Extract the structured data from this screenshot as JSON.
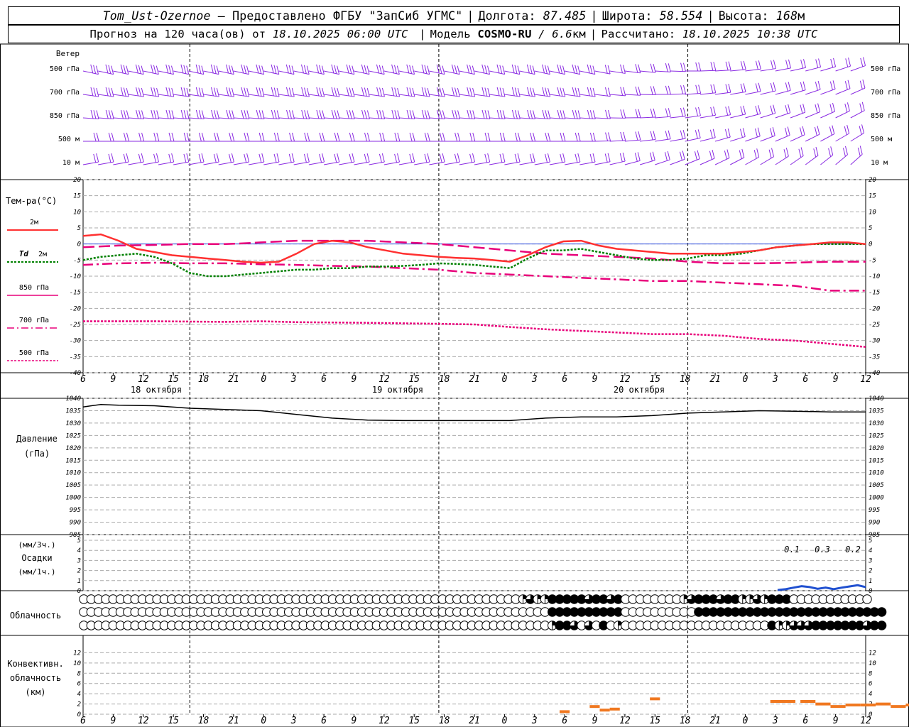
{
  "header": {
    "row1": {
      "station": "Tom_Ust-Ozernoe",
      "dash": " – ",
      "provider": "Предоставлено ФГБУ \"ЗапСиб УГМС\"",
      "lon_label": "Долгота:",
      "lon_value": "87.485",
      "lat_label": "Широта:",
      "lat_value": "58.554",
      "alt_label": "Высота:",
      "alt_value": "168",
      "alt_unit": "м"
    },
    "row2": {
      "forecast_label": "Прогноз на 120 часа(ов) от",
      "forecast_start": "18.10.2025 06:00 UTC",
      "model_label": "Модель",
      "model_name": "COSMO-RU",
      "model_res": "/ 6.6",
      "model_res_unit": "км",
      "calc_label": "Рассчитано:",
      "calc_value": "18.10.2025 10:38 UTC"
    }
  },
  "chart_data": {
    "type": "line",
    "x_hour_labels": [
      "6",
      "9",
      "12",
      "15",
      "18",
      "21",
      "0",
      "3",
      "6",
      "9",
      "12",
      "15",
      "18",
      "21",
      "0",
      "3",
      "6",
      "9",
      "12",
      "15",
      "18",
      "21",
      "0",
      "3",
      "6",
      "9",
      "12"
    ],
    "day_labels": [
      "18 октября",
      "19 октября",
      "20 октября"
    ],
    "colors": {
      "wind": "#8a2be2",
      "t2m": "#ff3030",
      "td2m": "#008000",
      "t850": "#e8007a",
      "t700": "#e8007a",
      "t500": "#e8007a",
      "pressure": "#000000",
      "precip": "#2050d0",
      "conv": "#f07820",
      "grid": "#aaaaaa"
    },
    "wind": {
      "title": "Ветер",
      "levels": [
        "500 гПа",
        "700 гПа",
        "850 гПа",
        "500 м",
        "10 м"
      ],
      "description": "wind barbs every 3 h on five levels"
    },
    "temperature": {
      "title": "Тем-ра(°С)",
      "ylim": [
        -40,
        20
      ],
      "yticks": [
        20,
        15,
        10,
        5,
        0,
        -5,
        -10,
        -15,
        -20,
        -25,
        -30,
        -35,
        -40
      ],
      "legend": {
        "t2m": "2м",
        "td_symbol": "Td",
        "td2m": "2м",
        "t850": "850 гПа",
        "t700": "700 гПа",
        "t500": "500 гПа"
      },
      "series": {
        "t2m": [
          [
            0,
            2.5
          ],
          [
            3,
            3
          ],
          [
            6,
            1
          ],
          [
            9,
            -1.5
          ],
          [
            12,
            -2.5
          ],
          [
            15,
            -3.5
          ],
          [
            18,
            -4
          ],
          [
            21,
            -4.5
          ],
          [
            24,
            -5
          ],
          [
            27,
            -5.5
          ],
          [
            30,
            -5.8
          ],
          [
            33,
            -5.5
          ],
          [
            36,
            -3
          ],
          [
            39,
            0
          ],
          [
            42,
            1
          ],
          [
            45,
            0.5
          ],
          [
            48,
            -1
          ],
          [
            51,
            -2
          ],
          [
            54,
            -3
          ],
          [
            57,
            -3.5
          ],
          [
            60,
            -4
          ],
          [
            63,
            -4.3
          ],
          [
            66,
            -4.5
          ],
          [
            69,
            -5
          ],
          [
            72,
            -5.5
          ],
          [
            75,
            -3.5
          ],
          [
            78,
            -1
          ],
          [
            81,
            0.8
          ],
          [
            84,
            1
          ],
          [
            87,
            -0.5
          ],
          [
            90,
            -1.5
          ],
          [
            93,
            -2
          ],
          [
            96,
            -2.5
          ],
          [
            99,
            -3
          ],
          [
            102,
            -3
          ],
          [
            105,
            -3
          ],
          [
            108,
            -3
          ],
          [
            111,
            -2.5
          ],
          [
            114,
            -2
          ],
          [
            117,
            -1
          ],
          [
            120,
            -0.5
          ],
          [
            123,
            0
          ],
          [
            126,
            0.5
          ],
          [
            129,
            0.5
          ],
          [
            132,
            0
          ]
        ],
        "td2m": [
          [
            0,
            -5
          ],
          [
            3,
            -4
          ],
          [
            6,
            -3.5
          ],
          [
            9,
            -3
          ],
          [
            12,
            -4
          ],
          [
            15,
            -6
          ],
          [
            18,
            -9
          ],
          [
            21,
            -10
          ],
          [
            24,
            -10
          ],
          [
            27,
            -9.5
          ],
          [
            30,
            -9
          ],
          [
            33,
            -8.5
          ],
          [
            36,
            -8
          ],
          [
            39,
            -8
          ],
          [
            42,
            -7.5
          ],
          [
            45,
            -7.5
          ],
          [
            48,
            -7
          ],
          [
            51,
            -7
          ],
          [
            54,
            -6.8
          ],
          [
            57,
            -6.5
          ],
          [
            60,
            -6
          ],
          [
            63,
            -6.2
          ],
          [
            66,
            -6.5
          ],
          [
            69,
            -7
          ],
          [
            72,
            -7.5
          ],
          [
            75,
            -4.5
          ],
          [
            78,
            -2
          ],
          [
            81,
            -2
          ],
          [
            84,
            -1.5
          ],
          [
            87,
            -2.5
          ],
          [
            90,
            -3.5
          ],
          [
            93,
            -4.5
          ],
          [
            96,
            -5
          ],
          [
            99,
            -5
          ],
          [
            102,
            -4.5
          ],
          [
            105,
            -3.5
          ],
          [
            108,
            -3.5
          ],
          [
            111,
            -3
          ],
          [
            114,
            -2
          ],
          [
            117,
            -1
          ],
          [
            120,
            -0.5
          ],
          [
            123,
            0
          ],
          [
            126,
            0
          ],
          [
            129,
            0
          ],
          [
            132,
            0
          ]
        ],
        "t850": [
          [
            0,
            -1
          ],
          [
            6,
            -0.5
          ],
          [
            12,
            -0.3
          ],
          [
            18,
            0
          ],
          [
            24,
            0
          ],
          [
            27,
            0.2
          ],
          [
            30,
            0.5
          ],
          [
            36,
            1
          ],
          [
            42,
            1
          ],
          [
            48,
            1
          ],
          [
            54,
            0.5
          ],
          [
            60,
            0
          ],
          [
            66,
            -1
          ],
          [
            72,
            -2
          ],
          [
            78,
            -3
          ],
          [
            84,
            -3.5
          ],
          [
            90,
            -4
          ],
          [
            96,
            -4.5
          ],
          [
            102,
            -5.5
          ],
          [
            108,
            -6
          ],
          [
            114,
            -6
          ],
          [
            120,
            -5.8
          ],
          [
            126,
            -5.5
          ],
          [
            132,
            -5.5
          ]
        ],
        "t700": [
          [
            0,
            -6.5
          ],
          [
            6,
            -6
          ],
          [
            12,
            -5.8
          ],
          [
            18,
            -6
          ],
          [
            24,
            -6
          ],
          [
            30,
            -6.3
          ],
          [
            36,
            -6.5
          ],
          [
            42,
            -6.8
          ],
          [
            48,
            -7
          ],
          [
            54,
            -7.5
          ],
          [
            60,
            -8
          ],
          [
            66,
            -9
          ],
          [
            72,
            -9.5
          ],
          [
            78,
            -10
          ],
          [
            84,
            -10.5
          ],
          [
            90,
            -11
          ],
          [
            96,
            -11.5
          ],
          [
            102,
            -11.5
          ],
          [
            108,
            -12
          ],
          [
            114,
            -12.5
          ],
          [
            120,
            -13
          ],
          [
            126,
            -14.5
          ],
          [
            132,
            -14.5
          ]
        ],
        "t500": [
          [
            0,
            -24
          ],
          [
            12,
            -24
          ],
          [
            24,
            -24.2
          ],
          [
            30,
            -24
          ],
          [
            36,
            -24.3
          ],
          [
            48,
            -24.5
          ],
          [
            60,
            -24.8
          ],
          [
            66,
            -25
          ],
          [
            72,
            -25.8
          ],
          [
            78,
            -26.5
          ],
          [
            84,
            -27
          ],
          [
            90,
            -27.5
          ],
          [
            96,
            -28
          ],
          [
            102,
            -28
          ],
          [
            108,
            -28.5
          ],
          [
            114,
            -29.5
          ],
          [
            120,
            -30
          ],
          [
            126,
            -31
          ],
          [
            132,
            -32
          ]
        ]
      }
    },
    "pressure": {
      "title": "Давление",
      "unit": "(гПа)",
      "ylim": [
        985,
        1040
      ],
      "yticks": [
        1040,
        1035,
        1030,
        1025,
        1020,
        1015,
        1010,
        1005,
        1000,
        995,
        990,
        985
      ],
      "values": [
        [
          0,
          1036.5
        ],
        [
          3,
          1037.5
        ],
        [
          6,
          1037.2
        ],
        [
          12,
          1037
        ],
        [
          18,
          1036
        ],
        [
          24,
          1035.5
        ],
        [
          30,
          1035
        ],
        [
          36,
          1033.5
        ],
        [
          42,
          1032
        ],
        [
          48,
          1031.2
        ],
        [
          54,
          1031
        ],
        [
          60,
          1031
        ],
        [
          66,
          1031
        ],
        [
          72,
          1031
        ],
        [
          78,
          1032
        ],
        [
          84,
          1032.5
        ],
        [
          90,
          1032.5
        ],
        [
          96,
          1033
        ],
        [
          102,
          1034
        ],
        [
          108,
          1034.5
        ],
        [
          114,
          1035
        ],
        [
          120,
          1034.8
        ],
        [
          126,
          1034.5
        ],
        [
          132,
          1034.5
        ]
      ]
    },
    "precip": {
      "title": "Осадки",
      "unit_top": "(мм/3ч.)",
      "unit_bottom": "(мм/1ч.)",
      "ylim": [
        0,
        5
      ],
      "yticks": [
        5,
        4,
        3,
        2,
        1,
        0
      ],
      "totals": [
        "0.1",
        "0.3",
        "0.2"
      ],
      "hourly": [
        [
          120,
          0.02
        ],
        [
          123,
          0.05
        ],
        [
          126,
          0.1
        ],
        [
          129,
          0.15
        ],
        [
          132,
          0.12
        ],
        [
          135,
          0.06
        ],
        [
          138,
          0.1
        ],
        [
          141,
          0.05
        ],
        [
          144,
          0.1
        ],
        [
          147,
          0.14
        ],
        [
          150,
          0.18
        ],
        [
          153,
          0.12
        ]
      ]
    },
    "cloud": {
      "title": "Облачность",
      "rows": [
        [
          0,
          0,
          0,
          0,
          0,
          0,
          0,
          0,
          0,
          0,
          0,
          0,
          0,
          0,
          0,
          0,
          0,
          0,
          0,
          0,
          0,
          0,
          0,
          0,
          0,
          0,
          0,
          0,
          0,
          0,
          0,
          0,
          0,
          0,
          0,
          0,
          0,
          0,
          0,
          0,
          0,
          0,
          0,
          0,
          0,
          0,
          0,
          0,
          0,
          0,
          0,
          0,
          0,
          0,
          0,
          0,
          0,
          0,
          0,
          0,
          2,
          3,
          2,
          2,
          4,
          4,
          4,
          4,
          4,
          3,
          4,
          4,
          3,
          4,
          0,
          0,
          0,
          0,
          0,
          0,
          0,
          0,
          2,
          3,
          4,
          4,
          4,
          3,
          4,
          4,
          2,
          2,
          3,
          2,
          4,
          4,
          4,
          0,
          0,
          0,
          0,
          0,
          0,
          0,
          0,
          0,
          0,
          0
        ],
        [
          0,
          0,
          0,
          0,
          0,
          0,
          0,
          0,
          0,
          0,
          0,
          0,
          0,
          0,
          0,
          0,
          0,
          0,
          0,
          0,
          0,
          0,
          0,
          0,
          0,
          0,
          0,
          0,
          0,
          0,
          0,
          0,
          0,
          0,
          0,
          0,
          0,
          0,
          0,
          0,
          0,
          0,
          0,
          0,
          0,
          0,
          0,
          0,
          0,
          0,
          0,
          0,
          0,
          0,
          0,
          0,
          0,
          0,
          0,
          0,
          0,
          0,
          0,
          0,
          4,
          4,
          4,
          4,
          4,
          4,
          4,
          4,
          4,
          4,
          0,
          0,
          0,
          0,
          0,
          0,
          0,
          0,
          0,
          0,
          4,
          4,
          4,
          4,
          4,
          4,
          4,
          4,
          4,
          4,
          4,
          4,
          4,
          4,
          4,
          4,
          4,
          4,
          4,
          4,
          4,
          4,
          4,
          4,
          4,
          4
        ],
        [
          0,
          0,
          0,
          0,
          0,
          0,
          0,
          0,
          0,
          0,
          0,
          0,
          0,
          0,
          0,
          0,
          0,
          0,
          0,
          0,
          0,
          0,
          0,
          0,
          0,
          0,
          0,
          0,
          0,
          0,
          0,
          0,
          0,
          0,
          0,
          0,
          0,
          0,
          0,
          0,
          0,
          0,
          0,
          0,
          0,
          0,
          0,
          0,
          0,
          0,
          0,
          0,
          0,
          0,
          0,
          0,
          0,
          0,
          0,
          0,
          0,
          0,
          0,
          0,
          2,
          4,
          4,
          3,
          0,
          3,
          0,
          4,
          0,
          2,
          0,
          0,
          0,
          0,
          0,
          0,
          0,
          0,
          0,
          0,
          0,
          0,
          0,
          0,
          0,
          0,
          0,
          0,
          0,
          0,
          4,
          2,
          2,
          3,
          3,
          3,
          4,
          4,
          4,
          4,
          4,
          4,
          4,
          3,
          4,
          4
        ]
      ]
    },
    "convective": {
      "title_line1": "Конвективн.",
      "title_line2": "облачность",
      "unit": "(км)",
      "ylim": [
        0,
        14
      ],
      "yticks": [
        12,
        10,
        8,
        6,
        4,
        2,
        0
      ],
      "segments": [
        [
          78,
          80,
          0.5
        ],
        [
          84,
          86,
          1.5
        ],
        [
          86,
          88,
          0.8
        ],
        [
          88,
          90,
          1
        ],
        [
          96,
          98,
          3
        ],
        [
          120,
          125,
          2.5
        ],
        [
          126,
          129,
          2.5
        ],
        [
          129,
          132,
          2
        ],
        [
          132,
          135,
          1.5
        ],
        [
          135,
          138,
          1.8
        ],
        [
          138,
          141,
          1.8
        ],
        [
          141,
          144,
          2
        ],
        [
          144,
          147,
          1.5
        ],
        [
          147,
          150,
          1.8
        ],
        [
          150,
          153,
          1.8
        ]
      ]
    }
  }
}
